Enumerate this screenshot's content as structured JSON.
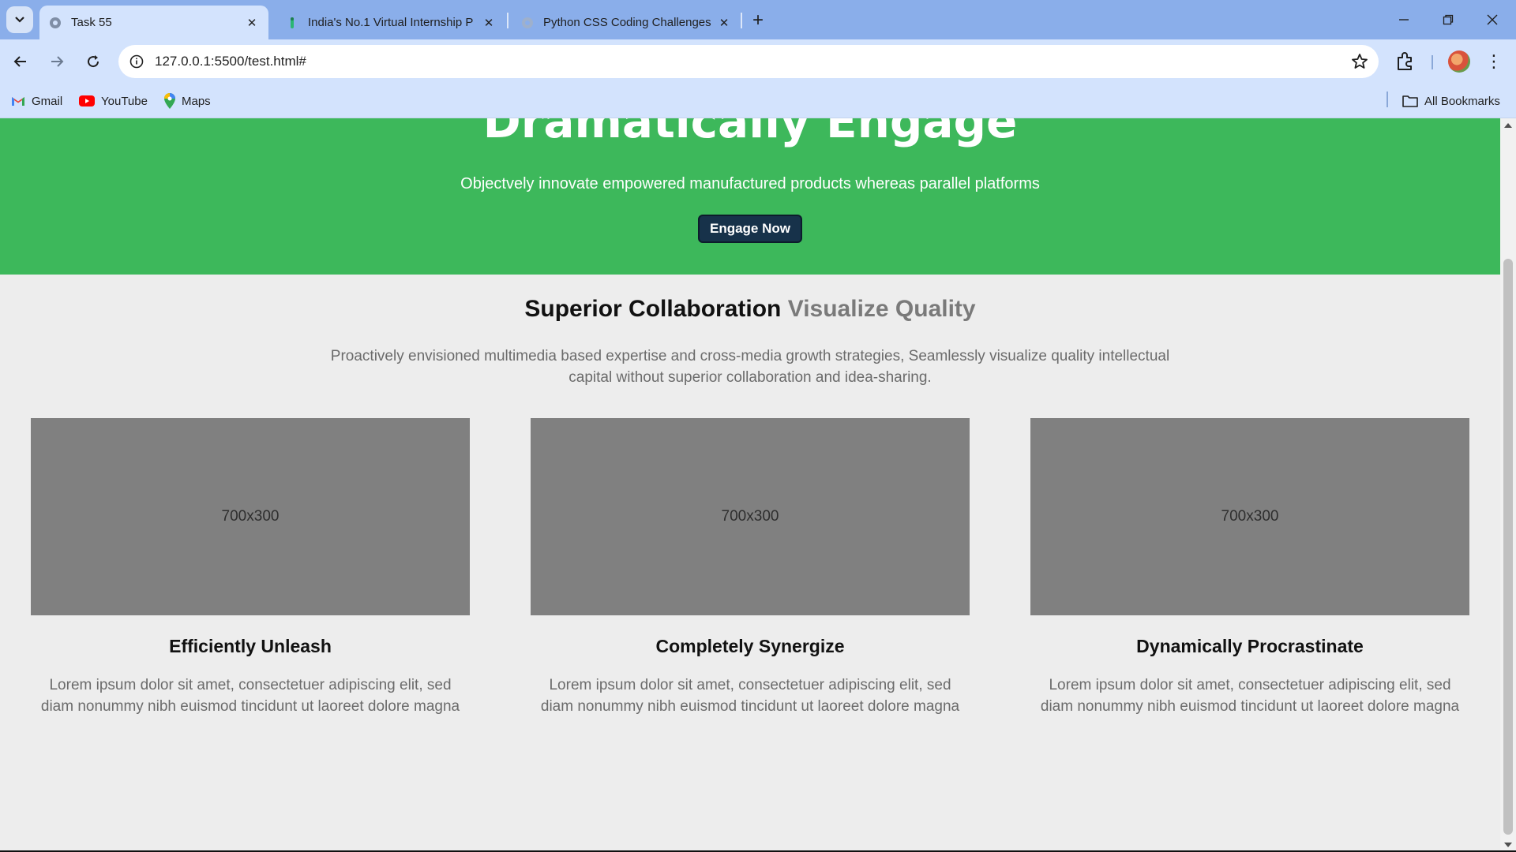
{
  "browser": {
    "tabs": [
      {
        "title": "Task 55",
        "active": true
      },
      {
        "title": "India's No.1 Virtual Internship P",
        "active": false
      },
      {
        "title": "Python CSS Coding Challenges",
        "active": false
      }
    ],
    "url": "127.0.0.1:5500/test.html#",
    "bookmarks": [
      {
        "label": "Gmail",
        "icon": "gmail-icon"
      },
      {
        "label": "YouTube",
        "icon": "youtube-icon"
      },
      {
        "label": "Maps",
        "icon": "maps-icon"
      }
    ],
    "all_bookmarks": "All Bookmarks"
  },
  "hero": {
    "title": "Dramatically Engage",
    "subtitle": "Objectvely innovate empowered manufactured products whereas parallel platforms",
    "button": "Engage Now",
    "bg_color": "#3db85b"
  },
  "section": {
    "title_dark": "Superior Collaboration",
    "title_muted": "Visualize Quality",
    "description": "Proactively envisioned multimedia based expertise and cross-media growth strategies, Seamlessly visualize quality intellectual capital without superior collaboration and idea-sharing."
  },
  "cards": [
    {
      "placeholder": "700x300",
      "title": "Efficiently Unleash",
      "text": "Lorem ipsum dolor sit amet, consectetuer adipiscing elit, sed diam nonummy nibh euismod tincidunt ut laoreet dolore magna"
    },
    {
      "placeholder": "700x300",
      "title": "Completely Synergize",
      "text": "Lorem ipsum dolor sit amet, consectetuer adipiscing elit, sed diam nonummy nibh euismod tincidunt ut laoreet dolore magna"
    },
    {
      "placeholder": "700x300",
      "title": "Dynamically Procrastinate",
      "text": "Lorem ipsum dolor sit amet, consectetuer adipiscing elit, sed diam nonummy nibh euismod tincidunt ut laoreet dolore magna"
    }
  ]
}
